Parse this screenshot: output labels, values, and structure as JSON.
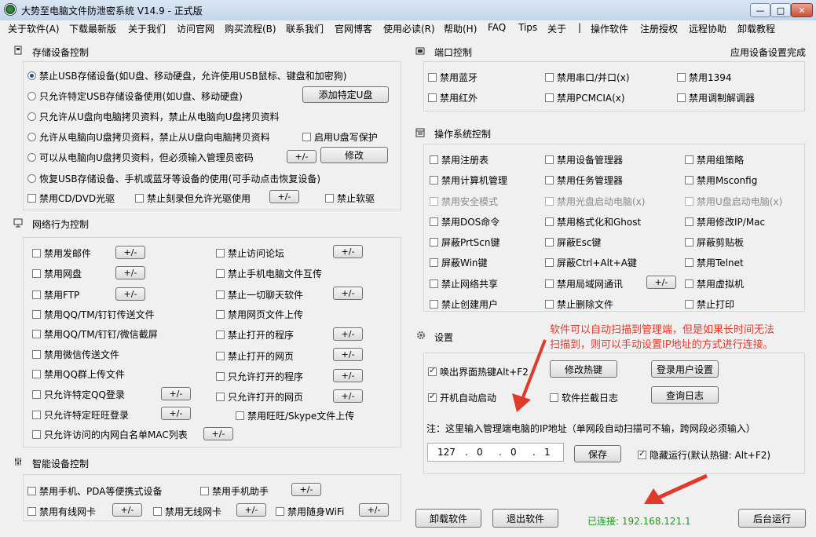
{
  "window": {
    "title": "大势至电脑文件防泄密系统 V14.9 - 正式版",
    "min": "—",
    "max": "□",
    "close": "✕"
  },
  "menu": [
    "关于软件(A)",
    "下载最新版",
    "关于我们",
    "访问官网",
    "购买流程(B)",
    "联系我们",
    "官网博客",
    "使用必读(R)",
    "帮助(H)",
    "FAQ",
    "Tips",
    "关于",
    "|",
    "操作软件",
    "注册授权",
    "远程协助",
    "卸载教程"
  ],
  "storage": {
    "title": "存储设备控制",
    "radios": [
      "禁止USB存储设备(如U盘、移动硬盘，允许使用USB鼠标、键盘和加密狗)",
      "只允许特定USB存储设备使用(如U盘、移动硬盘)",
      "只允许从U盘向电脑拷贝资料，禁止从电脑向U盘拷贝资料",
      "允许从电脑向U盘拷贝资料，禁止从U盘向电脑拷贝资料",
      "可以从电脑向U盘拷贝资料，但必须输入管理员密码",
      "恢复USB存储设备、手机或蓝牙等设备的使用(可手动点击恢复设备)"
    ],
    "add_udisk": "添加特定U盘",
    "u_write_protect": "启用U盘写保护",
    "pm": "+/-",
    "modify": "修改",
    "cd_dvd": "禁用CD/DVD光驱",
    "no_burn": "禁止刻录但允许光驱使用",
    "floppy": "禁止软驱"
  },
  "network": {
    "title": "网络行为控制",
    "left": [
      "禁用发邮件",
      "禁用网盘",
      "禁用FTP",
      "禁用QQ/TM/钉钉传送文件",
      "禁用QQ/TM/钉钉/微信截屏",
      "禁用微信传送文件",
      "禁用QQ群上传文件",
      "只允许特定QQ登录",
      "只允许特定旺旺登录",
      "只允许访问的内网白名单MAC列表"
    ],
    "right": [
      "禁止访问论坛",
      "禁止手机电脑文件互传",
      "禁止一切聊天软件",
      "禁用网页文件上传",
      "禁止打开的程序",
      "禁止打开的网页",
      "只允许打开的程序",
      "只允许打开的网页",
      "禁用旺旺/Skype文件上传"
    ]
  },
  "smart": {
    "title": "智能设备控制",
    "items": [
      "禁用手机、PDA等便携式设备",
      "禁用手机助手",
      "禁用有线网卡",
      "禁用无线网卡",
      "禁用随身WiFi"
    ]
  },
  "port": {
    "title": "端口控制",
    "status": "应用设备设置完成",
    "items": [
      "禁用蓝牙",
      "禁用串口/并口(x)",
      "禁用1394",
      "禁用红外",
      "禁用PCMCIA(x)",
      "禁用调制解调器"
    ]
  },
  "os": {
    "title": "操作系统控制",
    "rows": [
      [
        "禁用注册表",
        "禁用设备管理器",
        "禁用组策略"
      ],
      [
        "禁用计算机管理",
        "禁用任务管理器",
        "禁用Msconfig"
      ],
      [
        "禁用安全模式",
        "禁用光盘启动电脑(x)",
        "禁用U盘启动电脑(x)"
      ],
      [
        "禁用DOS命令",
        "禁用格式化和Ghost",
        "禁用修改IP/Mac"
      ],
      [
        "屏蔽PrtScn键",
        "屏蔽Esc键",
        "屏蔽剪贴板"
      ],
      [
        "屏蔽Win键",
        "屏蔽Ctrl+Alt+A键",
        "禁用Telnet"
      ],
      [
        "禁止网络共享",
        "禁用局域网通讯",
        "禁用虚拟机"
      ],
      [
        "禁止创建用户",
        "禁止删除文件",
        "禁止打印"
      ]
    ]
  },
  "settings": {
    "title": "设置",
    "hotkey_cb": "唤出界面热键Alt+F2",
    "modify_hotkey": "修改热键",
    "login_settings": "登录用户设置",
    "autostart": "开机自动启动",
    "intercept_log": "软件拦截日志",
    "query_log": "查询日志",
    "note": "注：这里输入管理端电脑的IP地址（单网段自动扫描可不输，跨网段必须输入）",
    "ip": [
      "127",
      "0",
      "0",
      "1"
    ],
    "save": "保存",
    "hide_run": "隐藏运行(默认热键: Alt+F2)"
  },
  "annotation": [
    "软件可以自动扫描到管理端，但是如果长时间无法",
    "扫描到，则可以手动设置IP地址的方式进行连接。"
  ],
  "footer": {
    "uninstall": "卸载软件",
    "exit": "退出软件",
    "connected": "已连接: 192.168.121.1",
    "background": "后台运行"
  },
  "colors": {
    "annotation": "#e03a2a",
    "connected": "#1a9a1a",
    "titlebar": "#c3d5ea"
  }
}
